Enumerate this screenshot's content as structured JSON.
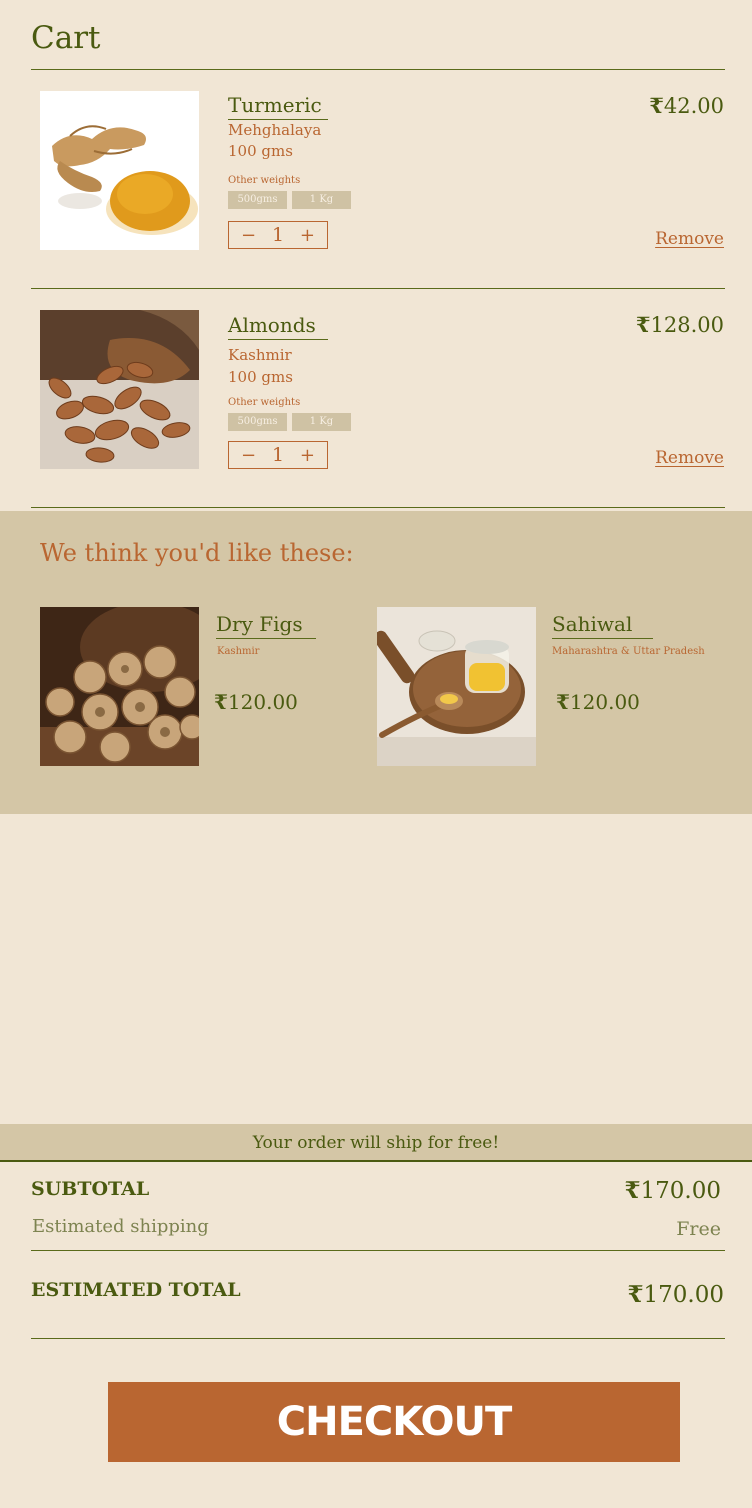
{
  "page": {
    "title": "Cart"
  },
  "currency": "₹",
  "cart": {
    "items": [
      {
        "name": "Turmeric",
        "origin": "Mehghalaya",
        "weight": "100 gms",
        "other_weights_label": "Other weights",
        "weights": [
          "500gms",
          "1 Kg"
        ],
        "quantity": "1",
        "price": "42.00",
        "remove_label": "Remove"
      },
      {
        "name": "Almonds",
        "origin": "Kashmir",
        "weight": "100 gms",
        "other_weights_label": "Other weights",
        "weights": [
          "500gms",
          "1 Kg"
        ],
        "quantity": "1",
        "price": "128.00",
        "remove_label": "Remove"
      }
    ],
    "minus_label": "−",
    "plus_label": "+"
  },
  "recommendations": {
    "title": "We think you'd like these:",
    "items": [
      {
        "name": "Dry Figs",
        "origin": "Kashmir",
        "price": "120.00"
      },
      {
        "name": "Sahiwal",
        "origin": "Maharashtra & Uttar Pradesh",
        "price": "120.00"
      }
    ]
  },
  "summary": {
    "shipping_banner": "Your order will ship for free!",
    "subtotal_label": "SUBTOTAL",
    "subtotal_value": "170.00",
    "shipping_label": "Estimated shipping",
    "shipping_value": "Free",
    "total_label": "ESTIMATED TOTAL",
    "total_value": "170.00"
  },
  "checkout_label": "CHECKOUT",
  "colors": {
    "background": "#f1e6d5",
    "accent_green": "#4a5a10",
    "accent_rust": "#b96631",
    "panel": "#d4c6a6"
  }
}
